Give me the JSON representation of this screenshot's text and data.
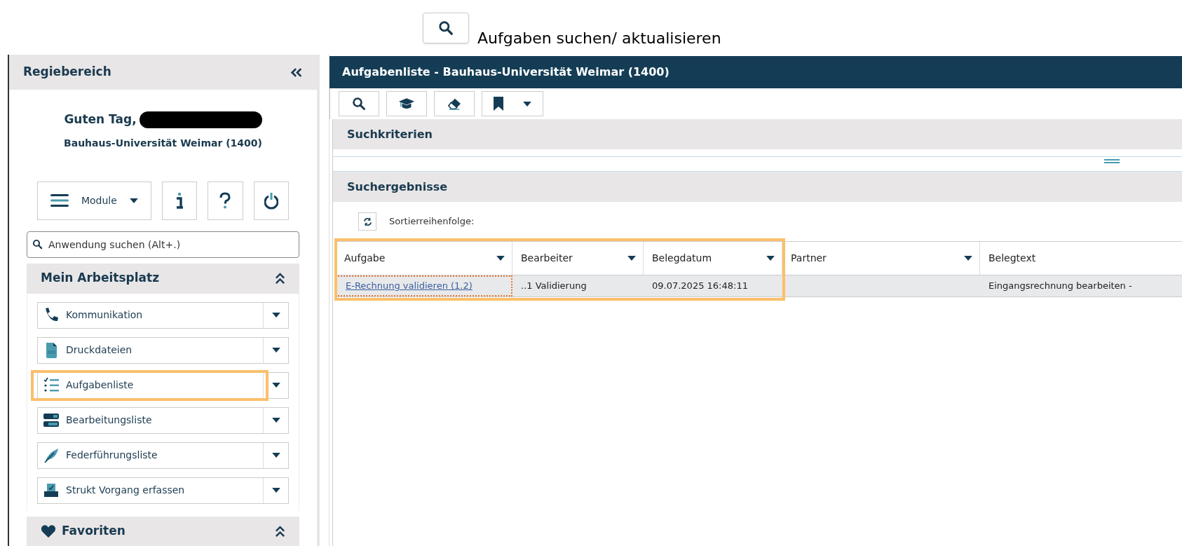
{
  "top_action": {
    "label": "Aufgaben suchen/ aktualisieren"
  },
  "sidebar": {
    "title": "Regiebereich",
    "greeting": "Guten Tag,",
    "organization": "Bauhaus-Universität Weimar (1400)",
    "modules_button": "Module",
    "search": {
      "placeholder": "Anwendung suchen (Alt+.)"
    },
    "sections": [
      {
        "title": "Mein Arbeitsplatz",
        "expanded": true,
        "items": [
          {
            "label": "Kommunikation",
            "kind": "phone",
            "highlighted": false
          },
          {
            "label": "Druckdateien",
            "kind": "pdf",
            "highlighted": false
          },
          {
            "label": "Aufgabenliste",
            "kind": "checklist",
            "highlighted": true
          },
          {
            "label": "Bearbeitungsliste",
            "kind": "toggles",
            "highlighted": false
          },
          {
            "label": "Federführungsliste",
            "kind": "feather",
            "highlighted": false
          },
          {
            "label": "Strukt Vorgang erfassen",
            "kind": "inbox",
            "highlighted": false
          }
        ]
      },
      {
        "title": "Favoriten",
        "expanded": true
      }
    ]
  },
  "main": {
    "title": "Aufgabenliste - Bauhaus-Universität Weimar (1400)",
    "search_criteria_title": "Suchkriterien",
    "results_title": "Suchergebnisse",
    "sort_label": "Sortierreihenfolge:",
    "table": {
      "columns": [
        {
          "label": "Aufgabe",
          "highlighted": true
        },
        {
          "label": "Bearbeiter",
          "highlighted": true
        },
        {
          "label": "Belegdatum",
          "highlighted": true
        },
        {
          "label": "Partner",
          "highlighted": false
        },
        {
          "label": "Belegtext",
          "highlighted": false
        }
      ],
      "rows": [
        {
          "selected": true,
          "cells": [
            "E-Rechnung validieren (1.2)",
            "..1 Validierung",
            "09.07.2025 16:48:11",
            "",
            "Eingangsrechnung bearbeiten -"
          ]
        }
      ]
    }
  }
}
